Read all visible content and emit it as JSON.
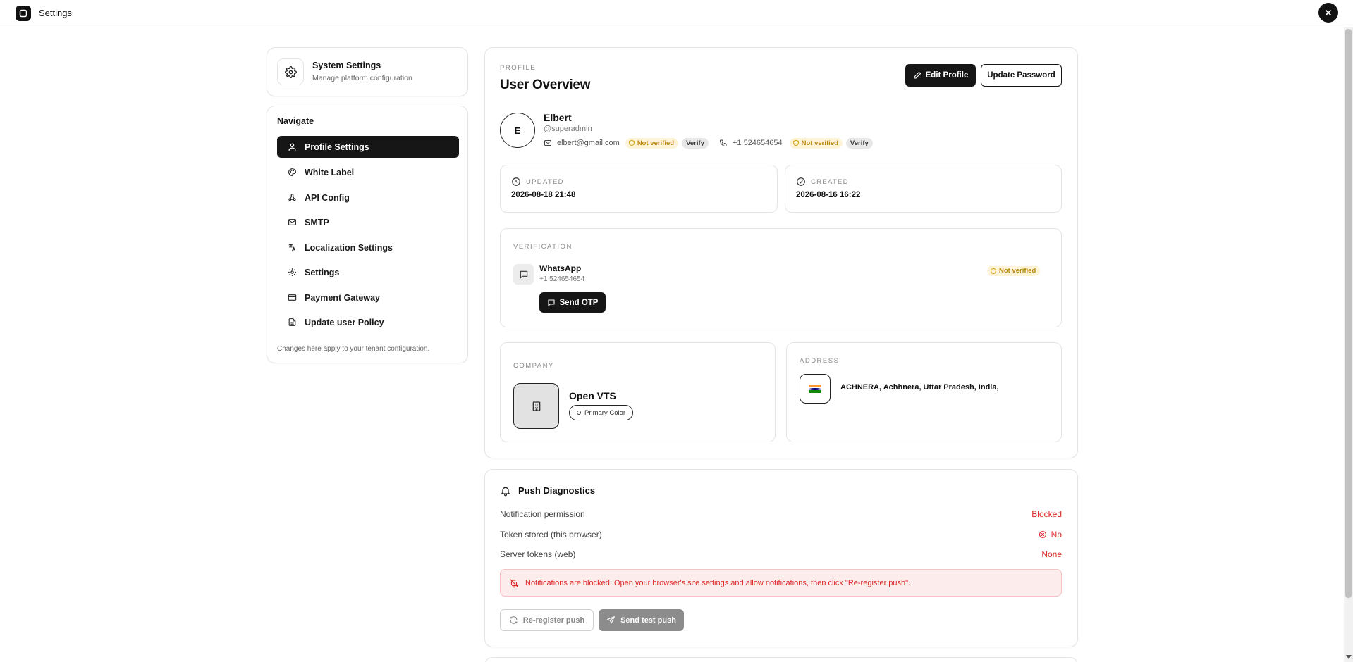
{
  "app": {
    "title": "Settings"
  },
  "system": {
    "title": "System Settings",
    "subtitle": "Manage platform configuration"
  },
  "nav": {
    "title": "Navigate",
    "items": [
      {
        "label": "Profile Settings",
        "icon": "user-icon",
        "active": true
      },
      {
        "label": "White Label",
        "icon": "palette-icon",
        "active": false
      },
      {
        "label": "API Config",
        "icon": "webhook-icon",
        "active": false
      },
      {
        "label": "SMTP",
        "icon": "mail-icon",
        "active": false
      },
      {
        "label": "Localization Settings",
        "icon": "languages-icon",
        "active": false
      },
      {
        "label": "Settings",
        "icon": "gear-icon",
        "active": false
      },
      {
        "label": "Payment Gateway",
        "icon": "credit-card-icon",
        "active": false
      },
      {
        "label": "Update user Policy",
        "icon": "file-text-icon",
        "active": false
      }
    ],
    "footer": "Changes here apply to your tenant configuration."
  },
  "profile": {
    "eyebrow": "PROFILE",
    "title": "User Overview",
    "edit_label": "Edit Profile",
    "password_label": "Update Password",
    "avatar_initial": "E",
    "name": "Elbert",
    "handle": "@superadmin",
    "email": "elbert@gmail.com",
    "email_status": "Not verified",
    "email_verify": "Verify",
    "phone": "+1 524654654",
    "phone_status": "Not verified",
    "phone_verify": "Verify"
  },
  "dates": {
    "updated_label": "UPDATED",
    "updated_value": "2026-08-18 21:48",
    "created_label": "CREATED",
    "created_value": "2026-08-16 16:22"
  },
  "verification": {
    "eyebrow": "VERIFICATION",
    "channel": "WhatsApp",
    "number": "+1 524654654",
    "status": "Not verified",
    "send_label": "Send OTP"
  },
  "company": {
    "eyebrow": "COMPANY",
    "name": "Open VTS",
    "primary_color_label": "Primary Color"
  },
  "address": {
    "eyebrow": "ADDRESS",
    "text": "ACHNERA, Achhnera, Uttar Pradesh, India,"
  },
  "push": {
    "title": "Push Diagnostics",
    "rows": [
      {
        "label": "Notification permission",
        "value": "Blocked"
      },
      {
        "label": "Token stored (this browser)",
        "value": "No"
      },
      {
        "label": "Server tokens (web)",
        "value": "None"
      }
    ],
    "alert": "Notifications are blocked. Open your browser's site settings and allow notifications, then click \"Re-register push\".",
    "reregister_label": "Re-register push",
    "test_label": "Send test push"
  },
  "colors": {
    "dark": "#161616",
    "warning_bg": "#fdf4d8",
    "warning_text": "#b8860b",
    "danger": "#dc2626",
    "danger_bg": "#fdecec"
  }
}
